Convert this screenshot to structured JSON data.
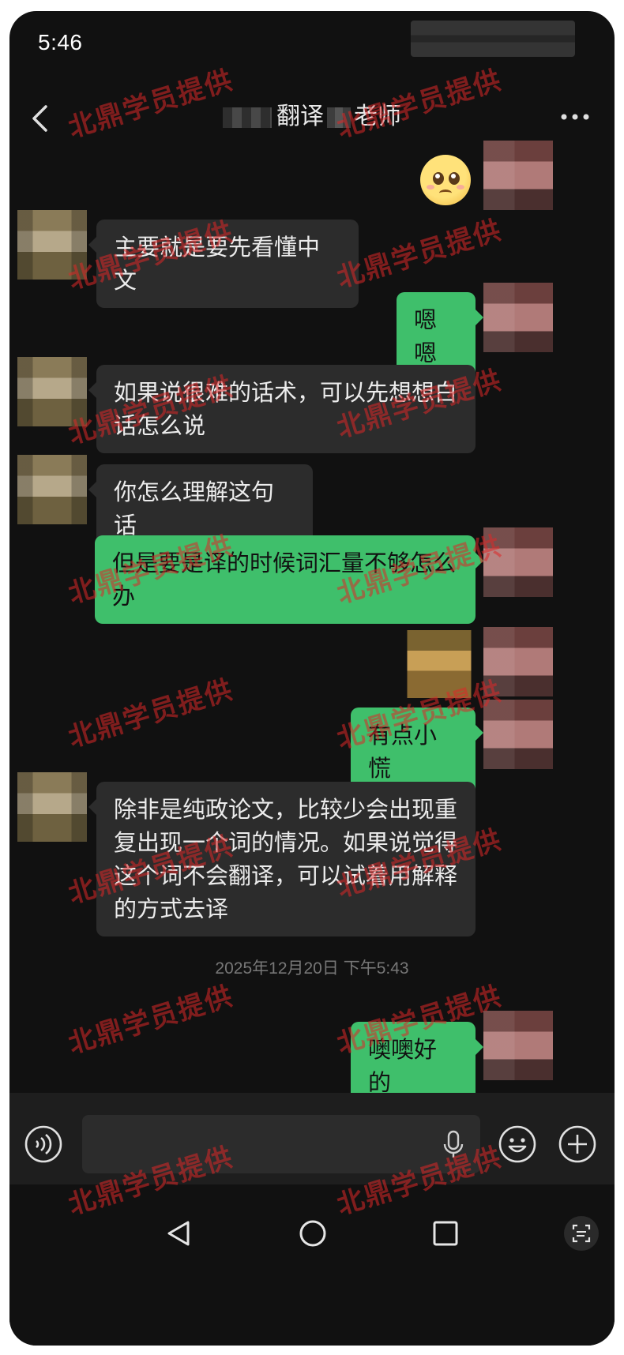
{
  "status_bar": {
    "time": "5:46"
  },
  "header": {
    "title_part1": "翻译",
    "title_part2": "老师"
  },
  "messages": [
    {
      "side": "right",
      "kind": "sticker"
    },
    {
      "side": "left",
      "text": "主要就是要先看懂中文"
    },
    {
      "side": "right",
      "text": "嗯嗯"
    },
    {
      "side": "left",
      "text": "如果说很难的话术，可以先想想白话怎么说"
    },
    {
      "side": "left",
      "text": "你怎么理解这句话"
    },
    {
      "side": "right",
      "text": "但是要是译的时候词汇量不够怎么办"
    },
    {
      "side": "right",
      "kind": "image"
    },
    {
      "side": "right",
      "text": "有点小慌"
    },
    {
      "side": "left",
      "text": "除非是纯政论文，比较少会出现重复出现一个词的情况。如果说觉得这个词不会翻译，可以试着用解释的方式去译"
    },
    {
      "side": "right",
      "text": "噢噢好的"
    }
  ],
  "timestamp": "2025年12月20日 下午5:43",
  "input": {
    "value": ""
  },
  "watermark": "北鼎学员提供",
  "colors": {
    "bubble_right": "#3fbf6b",
    "bubble_left": "#2c2c2c",
    "background": "#111111",
    "watermark": "#dc2828"
  },
  "icons": [
    "back-icon",
    "more-icon",
    "voice-icon",
    "mic-icon",
    "emoji-icon",
    "plus-icon",
    "nav-back-icon",
    "nav-home-icon",
    "nav-recents-icon",
    "scan-icon"
  ]
}
